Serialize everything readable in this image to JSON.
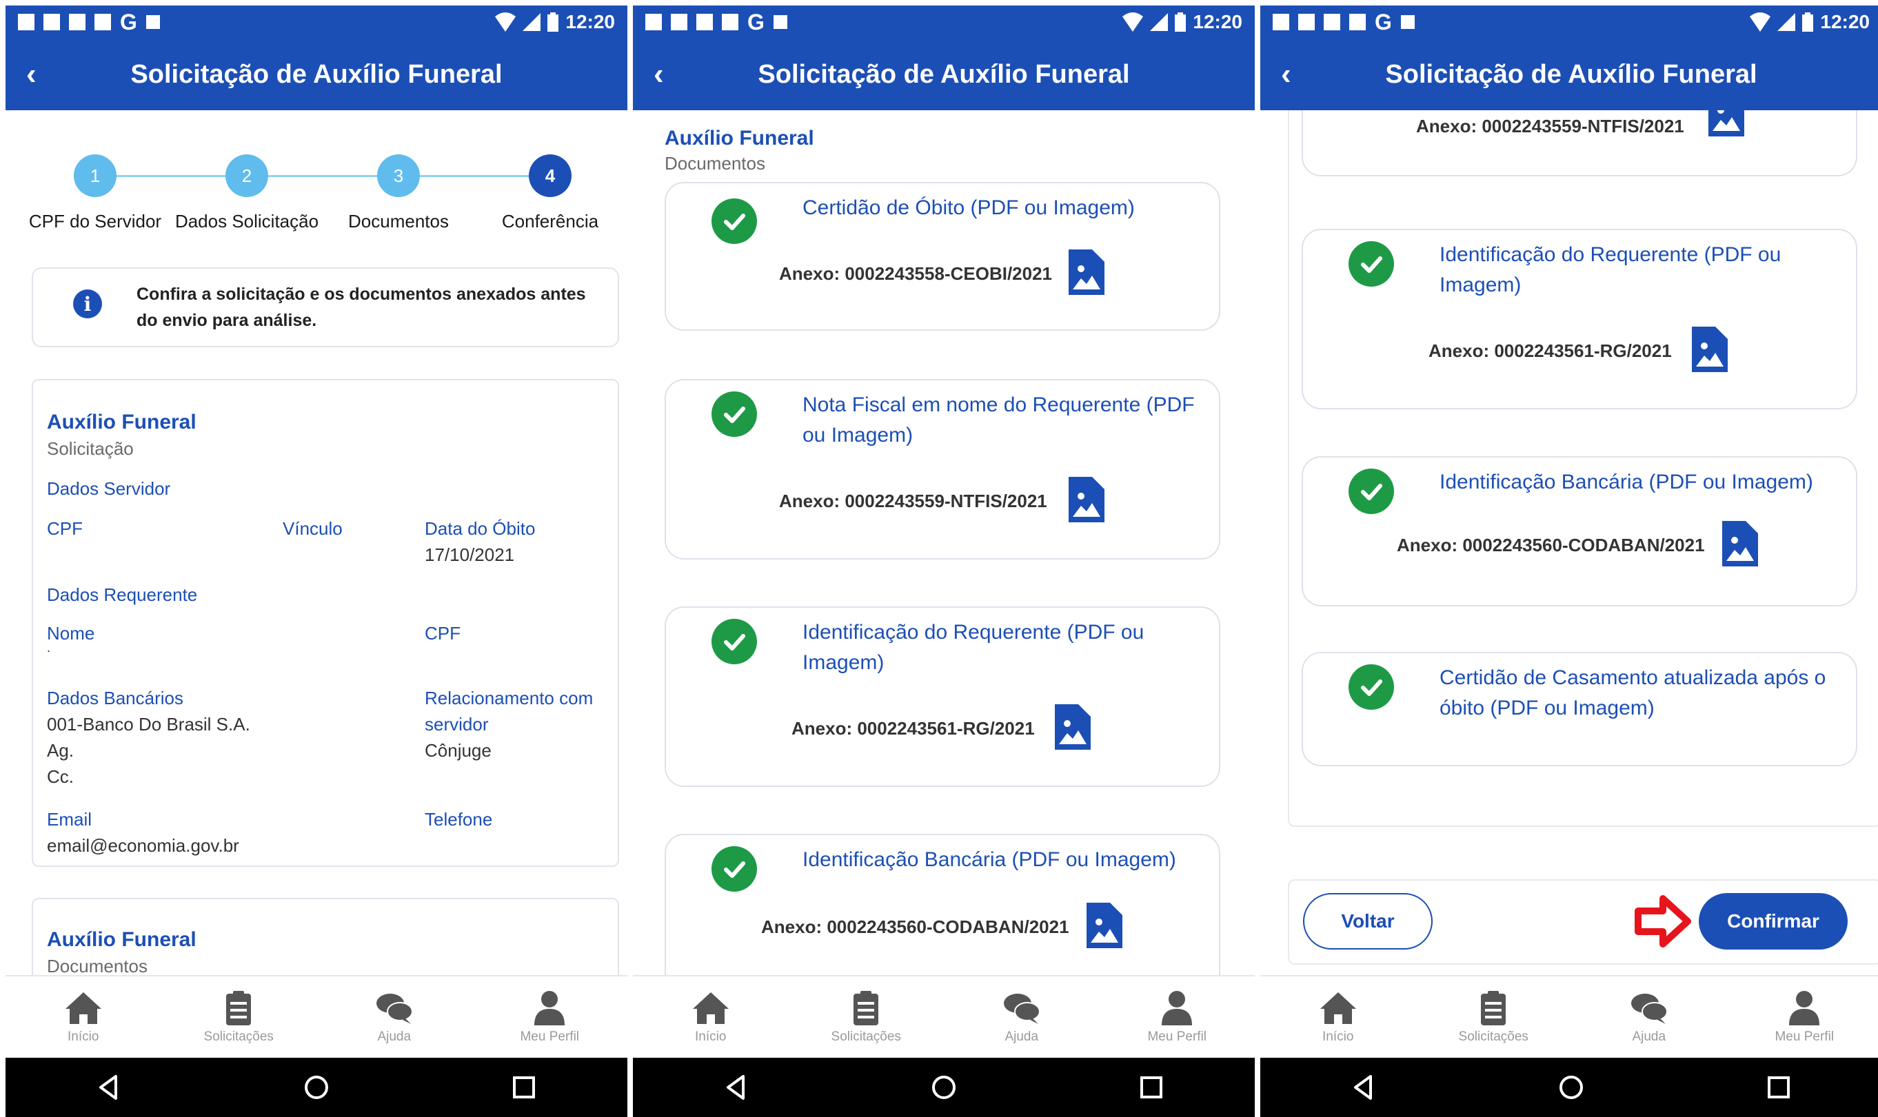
{
  "status_bar": {
    "time": "12:20"
  },
  "app_bar": {
    "title": "Solicitação de Auxílio Funeral"
  },
  "nav": {
    "inicio": "Início",
    "solicitacoes": "Solicitações",
    "ajuda": "Ajuda",
    "perfil": "Meu Perfil"
  },
  "screen1": {
    "steps": [
      {
        "number": "1",
        "label": "CPF do Servidor"
      },
      {
        "number": "2",
        "label": "Dados Solicitação"
      },
      {
        "number": "3",
        "label": "Documentos"
      },
      {
        "number": "4",
        "label": "Conferência"
      }
    ],
    "info_line1": "Confira a solicitação e os documentos anexados antes",
    "info_line2": "do envio para análise.",
    "summary": {
      "title": "Auxílio Funeral",
      "subtitle": "Solicitação",
      "dados_servidor": "Dados Servidor",
      "cpf_label": "CPF",
      "vinculo_label": "Vínculo",
      "data_obito_label": "Data do Óbito",
      "data_obito_value": "17/10/2021",
      "dados_requerente": "Dados Requerente",
      "nome_label": "Nome",
      "nome_value": ".",
      "cpf_req_label": "CPF",
      "dados_bancarios": "Dados Bancários",
      "banco_value": "001-Banco Do Brasil S.A.",
      "agencia_value": "Ag.",
      "conta_value": "Cc.",
      "relacionamento_line1": "Relacionamento com",
      "relacionamento_line2": "servidor",
      "relacionamento_value": "Cônjuge",
      "email_label": "Email",
      "email_value": "email@economia.gov.br",
      "telefone_label": "Telefone"
    },
    "documents_card": {
      "title": "Auxílio Funeral",
      "subtitle": "Documentos"
    }
  },
  "screen2": {
    "header_title": "Auxílio Funeral",
    "header_subtitle": "Documentos",
    "docs": [
      {
        "title_l1": "Certidão de Óbito (PDF ou Imagem)",
        "title_l2": "",
        "annex": "Anexo: 0002243558-CEOBI/2021"
      },
      {
        "title_l1": "Nota Fiscal em nome do Requerente (PDF",
        "title_l2": "ou Imagem)",
        "annex": "Anexo: 0002243559-NTFIS/2021"
      },
      {
        "title_l1": "Identificação do Requerente (PDF ou",
        "title_l2": "Imagem)",
        "annex": "Anexo: 0002243561-RG/2021"
      },
      {
        "title_l1": "Identificação Bancária (PDF ou Imagem)",
        "title_l2": "",
        "annex": "Anexo: 0002243560-CODABAN/2021"
      }
    ]
  },
  "screen3": {
    "partial_annex": "Anexo: 0002243559-NTFIS/2021",
    "docs": [
      {
        "title_l1": "Identificação do Requerente (PDF ou",
        "title_l2": "Imagem)",
        "annex": "Anexo: 0002243561-RG/2021"
      },
      {
        "title_l1": "Identificação Bancária (PDF ou Imagem)",
        "title_l2": "",
        "annex": "Anexo: 0002243560-CODABAN/2021"
      },
      {
        "title_l1": "Certidão de Casamento atualizada após o",
        "title_l2": "óbito (PDF ou Imagem)",
        "annex": ""
      }
    ],
    "btn_voltar": "Voltar",
    "btn_confirmar": "Confirmar"
  },
  "colors": {
    "primary": "#1c4fb5",
    "step_light": "#5fbcec",
    "check_green": "#1e9a47",
    "arrow_red": "#e8141c"
  }
}
